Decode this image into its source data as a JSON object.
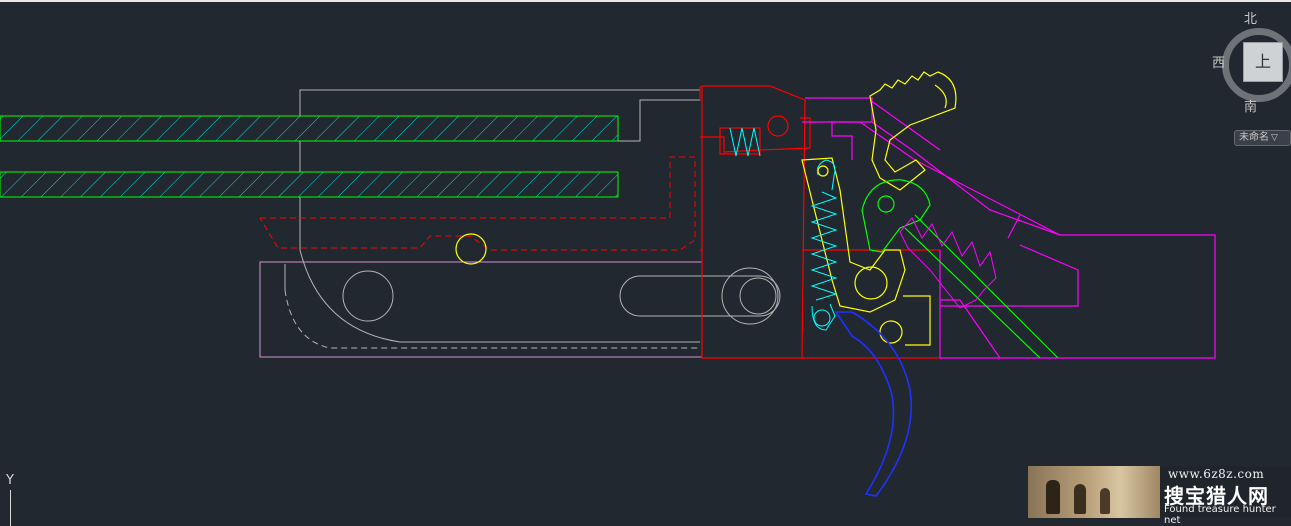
{
  "viewcube": {
    "north": "北",
    "west": "西",
    "south": "南",
    "face": "上"
  },
  "ucs_menu": {
    "label": "未命名",
    "chevron": "▽"
  },
  "ucs_icon": {
    "y_label": "Y"
  },
  "watermark": {
    "url": "www.6z8z.com",
    "chinese": "搜宝猎人网",
    "english": "Found treasure hunter net"
  },
  "colors": {
    "background": "#212830",
    "red": "#ff0000",
    "magenta": "#ff00ff",
    "yellow": "#ffff00",
    "cyan": "#00ffff",
    "green": "#00ff00",
    "blue": "#0000ff",
    "grey": "#b4b4b4"
  }
}
